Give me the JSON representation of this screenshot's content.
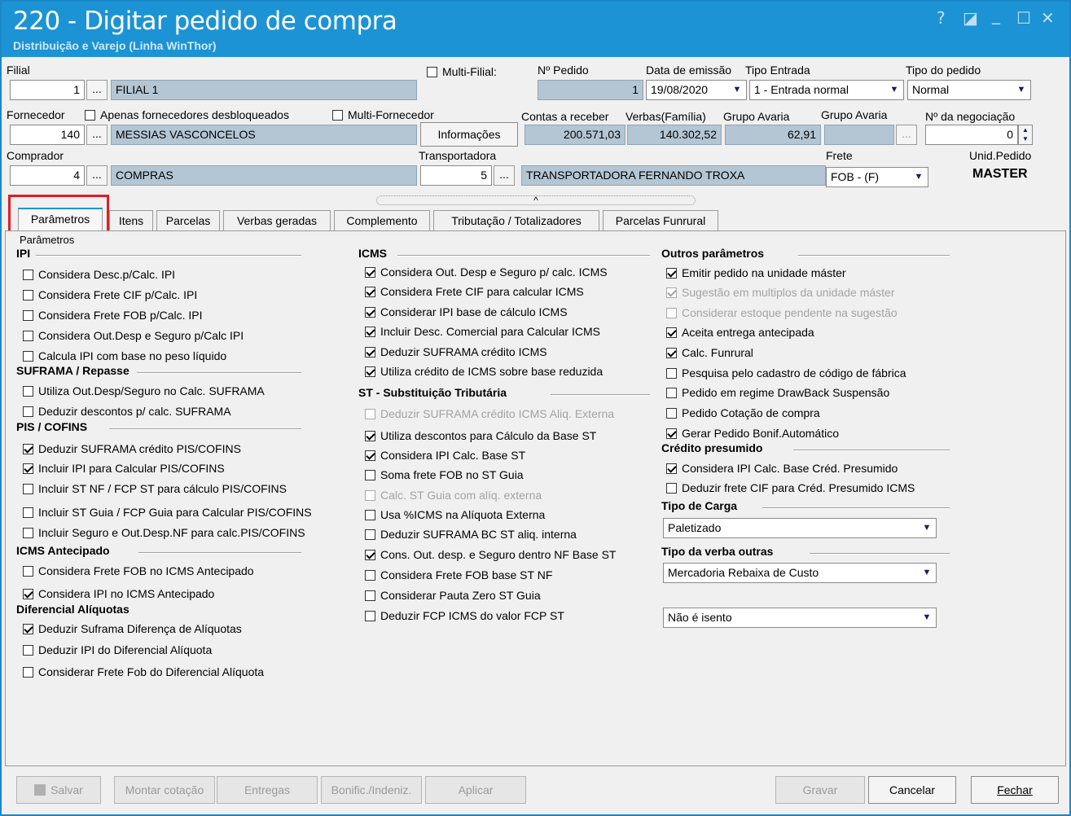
{
  "window": {
    "title": "220 - Digitar pedido de compra",
    "subtitle": "Distribuição e Varejo (Linha WinThor)",
    "controls": [
      "?",
      "◪",
      "_",
      "☐",
      "✕"
    ]
  },
  "header": {
    "filial_label": "Filial",
    "filial_code": "1",
    "filial_name": "FILIAL 1",
    "multi_filial": "Multi-Filial:",
    "pedido_label": "Nº Pedido",
    "pedido": "1",
    "emissao_label": "Data de emissão",
    "emissao": "19/08/2020",
    "tipo_entrada_label": "Tipo Entrada",
    "tipo_entrada": "1 - Entrada normal",
    "tipo_pedido_label": "Tipo do pedido",
    "tipo_pedido": "Normal",
    "fornecedor_label": "Fornecedor",
    "apenas_desbloq": "Apenas fornecedores desbloqueados",
    "multi_fornecedor": "Multi-Fornecedor",
    "fornecedor_code": "140",
    "fornecedor_name": "MESSIAS VASCONCELOS",
    "informacoes": "Informações",
    "contas_label": "Contas a receber",
    "contas": "200.571,03",
    "verbas_label": "Verbas(Família)",
    "verbas": "140.302,52",
    "grupo_avaria_label": "Grupo Avaria",
    "grupo_avaria": "62,91",
    "grupo_avaria2_label": "Grupo Avaria",
    "negociacao_label": "Nº da negociação",
    "negociacao": "0",
    "comprador_label": "Comprador",
    "comprador_code": "4",
    "comprador_name": "COMPRAS",
    "transp_label": "Transportadora",
    "transp_code": "5",
    "transp_name": "TRANSPORTADORA FERNANDO TROXA",
    "frete_label": "Frete",
    "frete": "FOB - (F)",
    "unid_label": "Unid.Pedido",
    "unid": "MASTER",
    "dots": "...",
    "collapse": "^"
  },
  "tabs": [
    "Parâmetros",
    "Itens",
    "Parcelas",
    "Verbas geradas",
    "Complemento",
    "Tributação / Totalizadores",
    "Parcelas Funrural"
  ],
  "panel_caption": "Parâmetros",
  "col1": {
    "ipi_title": "IPI",
    "ipi": [
      "Considera Desc.p/Calc. IPI",
      "Considera Frete CIF p/Calc. IPI",
      "Considera Frete FOB p/Calc. IPI",
      "Considera Out.Desp e Seguro p/Calc IPI",
      "Calcula IPI com base no peso líquido"
    ],
    "suframa_title": "SUFRAMA / Repasse",
    "suframa": [
      "Utiliza Out.Desp/Seguro no Calc. SUFRAMA",
      "Deduzir descontos p/ calc. SUFRAMA"
    ],
    "pis_title": "PIS / COFINS",
    "pis": [
      "Deduzir SUFRAMA crédito PIS/COFINS",
      "Incluir IPI para Calcular PIS/COFINS",
      "Incluir ST NF / FCP ST para cálculo PIS/COFINS",
      "Incluir ST Guia / FCP Guia para Calcular PIS/COFINS",
      "Incluir Seguro e Out.Desp.NF para calc.PIS/COFINS"
    ],
    "icmsant_title": "ICMS Antecipado",
    "icmsant": [
      "Considera Frete FOB no ICMS Antecipado",
      "Considera IPI no ICMS Antecipado"
    ],
    "dif_title": "Diferencial Alíquotas",
    "dif": [
      "Deduzir Suframa Diferença de Alíquotas",
      "Deduzir IPI do Diferencial Alíquota",
      "Considerar Frete Fob do Diferencial Alíquota"
    ]
  },
  "col2": {
    "icms_title": "ICMS",
    "icms": [
      "Considera Out. Desp e Seguro p/ calc. ICMS",
      "Considera Frete CIF para calcular ICMS",
      "Considerar IPI base de cálculo ICMS",
      "Incluir Desc. Comercial  para Calcular ICMS",
      "Deduzir SUFRAMA crédito ICMS",
      "Utiliza crédito de ICMS sobre base reduzida"
    ],
    "st_title": "ST - Substituição Tributária",
    "st": [
      "Deduzir SUFRAMA crédito ICMS Aliq. Externa",
      "Utiliza descontos para Cálculo da Base ST",
      "Considera IPI Calc. Base ST",
      "Soma frete FOB no ST Guia",
      "Calc. ST Guia com alíq. externa",
      "Usa %ICMS na Alíquota Externa",
      "Deduzir SUFRAMA BC ST aliq. interna",
      "Cons. Out. desp. e Seguro dentro NF Base ST",
      "Considera Frete FOB base ST NF",
      "Considerar Pauta Zero ST Guia",
      "Deduzir FCP ICMS do valor FCP ST"
    ]
  },
  "col3": {
    "outros_title": "Outros parâmetros",
    "outros": [
      "Emitir pedido na unidade máster",
      "Sugestão em multiplos da unidade máster",
      "Considerar estoque pendente na sugestão",
      "Aceita entrega antecipada",
      "Calc. Funrural",
      "Pesquisa pelo cadastro de código de fábrica",
      "Pedido em regime DrawBack Suspensão",
      "Pedido Cotação de compra",
      "Gerar Pedido Bonif.Automático"
    ],
    "credito_title": "Crédito presumido",
    "credito": [
      "Considera IPI Calc. Base Créd. Presumido",
      "Deduzir frete CIF para Créd. Presumido ICMS"
    ],
    "carga_title": "Tipo de Carga",
    "carga": "Paletizado",
    "verba_title": "Tipo da verba outras",
    "verba": "Mercadoria Rebaixa de Custo",
    "isento": "Não é isento"
  },
  "buttons": {
    "salvar": "Salvar",
    "montar": "Montar cotação",
    "entregas": "Entregas",
    "bonific": "Bonific./Indeniz.",
    "aplicar": "Aplicar",
    "gravar": "Gravar",
    "cancelar": "Cancelar",
    "fechar": "Fechar"
  },
  "colors": {
    "titlebar": "#1c93d4",
    "readonly": "#b4c6d4",
    "highlight": "#e01e25"
  }
}
